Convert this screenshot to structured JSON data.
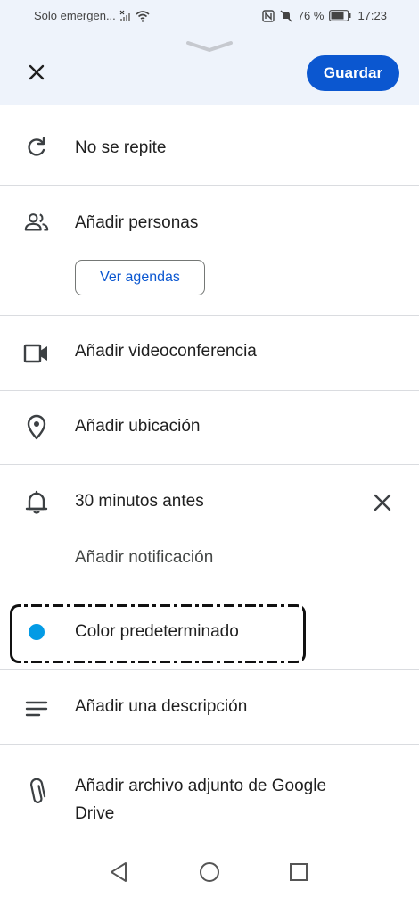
{
  "status_bar": {
    "left_text": "Solo emergen...",
    "battery": "76 %",
    "time": "17:23"
  },
  "header": {
    "save_label": "Guardar"
  },
  "rows": {
    "repeat": "No se repite",
    "people": "Añadir personas",
    "view_calendars": "Ver agendas",
    "videoconference": "Añadir videoconferencia",
    "location": "Añadir ubicación",
    "notification": "30 minutos antes",
    "add_notification": "Añadir notificación",
    "color": "Color predeterminado",
    "description": "Añadir una descripción",
    "attachment_line1": "Añadir archivo adjunto de Google",
    "attachment_line2": "Drive"
  },
  "colors": {
    "accent": "#0b57d0",
    "event_color": "#039be5",
    "top_background": "#eef3fb"
  },
  "icons": [
    "repeat-icon",
    "people-icon",
    "videocam-icon",
    "location-icon",
    "bell-icon",
    "close-icon",
    "notes-icon",
    "attach-icon",
    "back-icon",
    "home-icon",
    "recents-icon"
  ]
}
